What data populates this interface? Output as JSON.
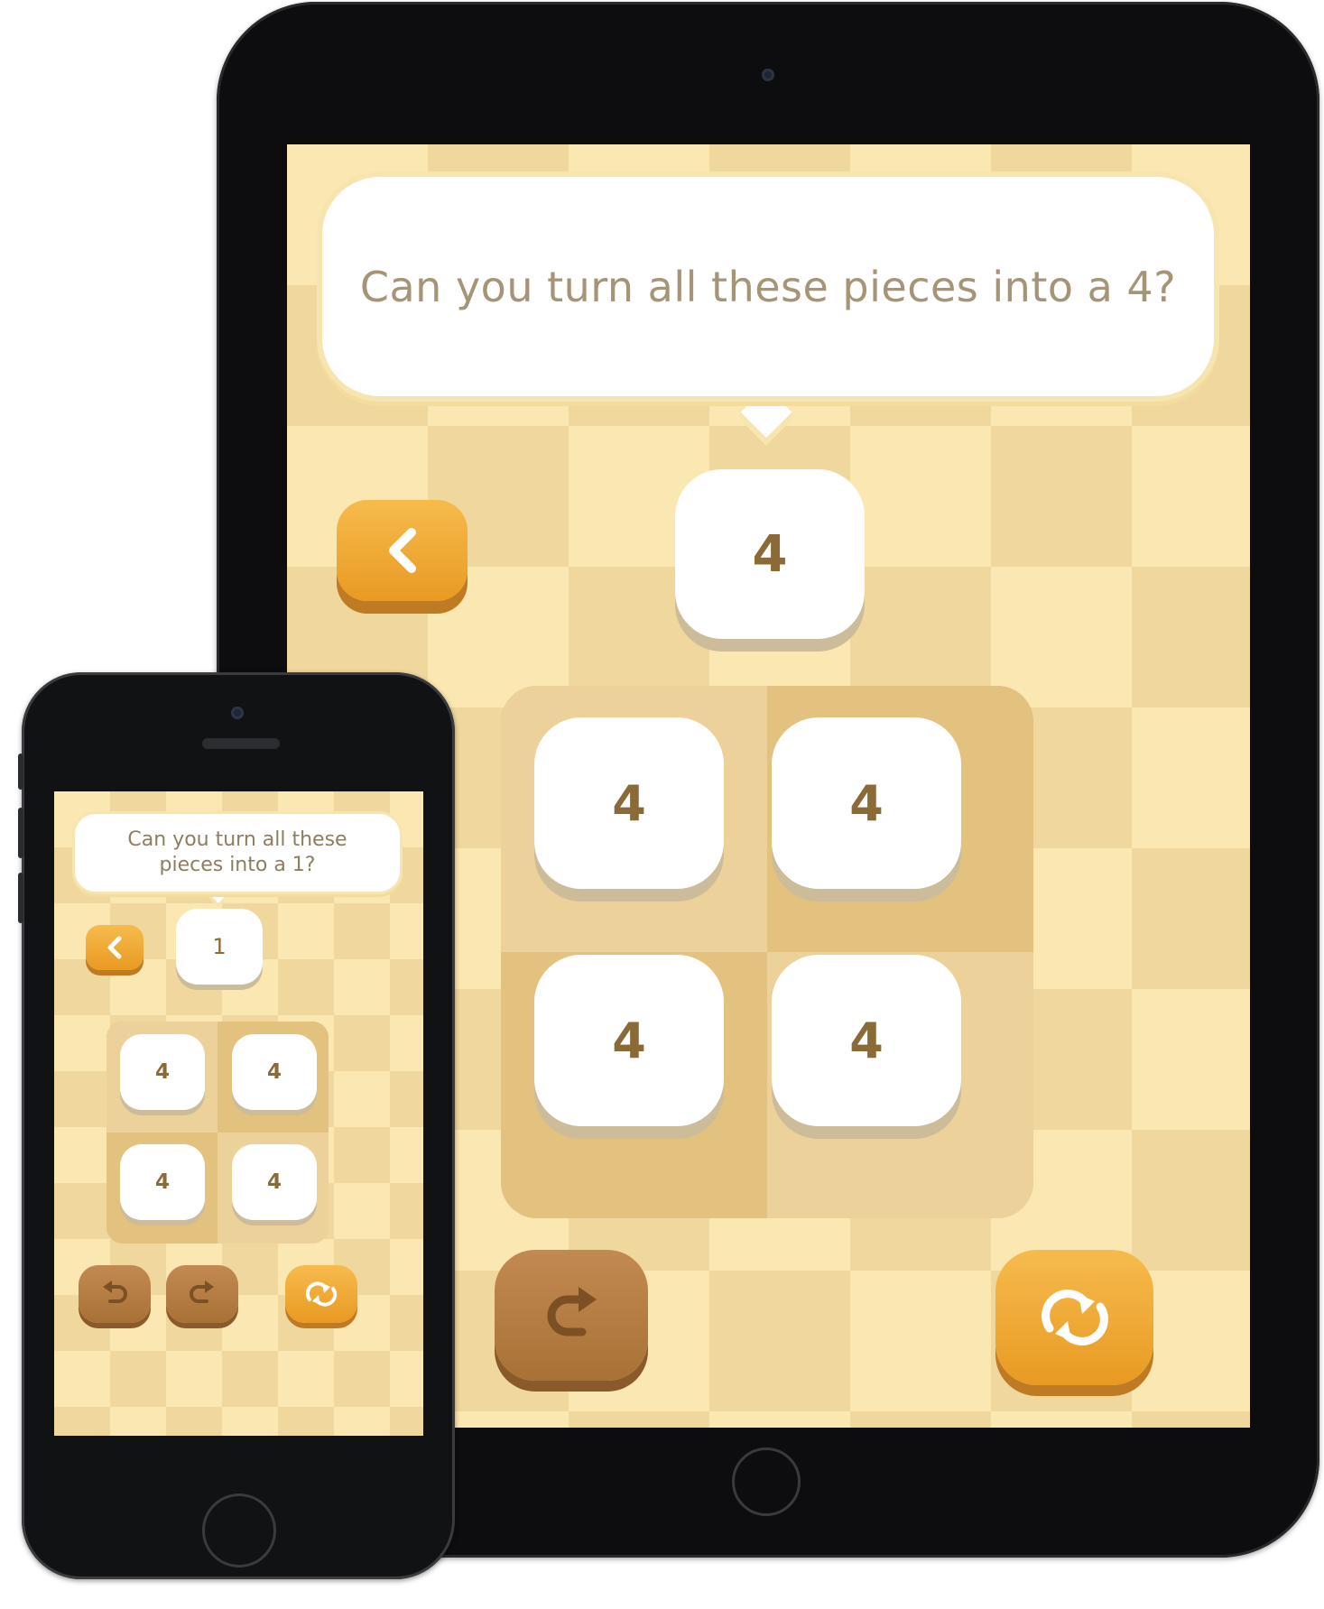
{
  "tablet": {
    "prompt": "Can you turn all these pieces into a 4?",
    "target_value": "4",
    "tiles": [
      "4",
      "4",
      "4",
      "4"
    ],
    "controls": {
      "back_icon": "chevron-left-icon",
      "redo_icon": "redo-icon",
      "restart_icon": "restart-icon"
    }
  },
  "phone": {
    "prompt": "Can you turn all these pieces into a 1?",
    "target_value": "1",
    "tiles": [
      "4",
      "4",
      "4",
      "4"
    ],
    "controls": {
      "back_icon": "chevron-left-icon",
      "undo_icon": "undo-icon",
      "redo_icon": "redo-icon",
      "restart_icon": "restart-icon"
    }
  },
  "colors": {
    "board_light": "#fbe7b1",
    "board_dark": "#f0d79e",
    "accent_orange": "#e99a23",
    "button_brown": "#a87135",
    "tile_text": "#8a6a36",
    "prompt_text": "#a59476"
  }
}
